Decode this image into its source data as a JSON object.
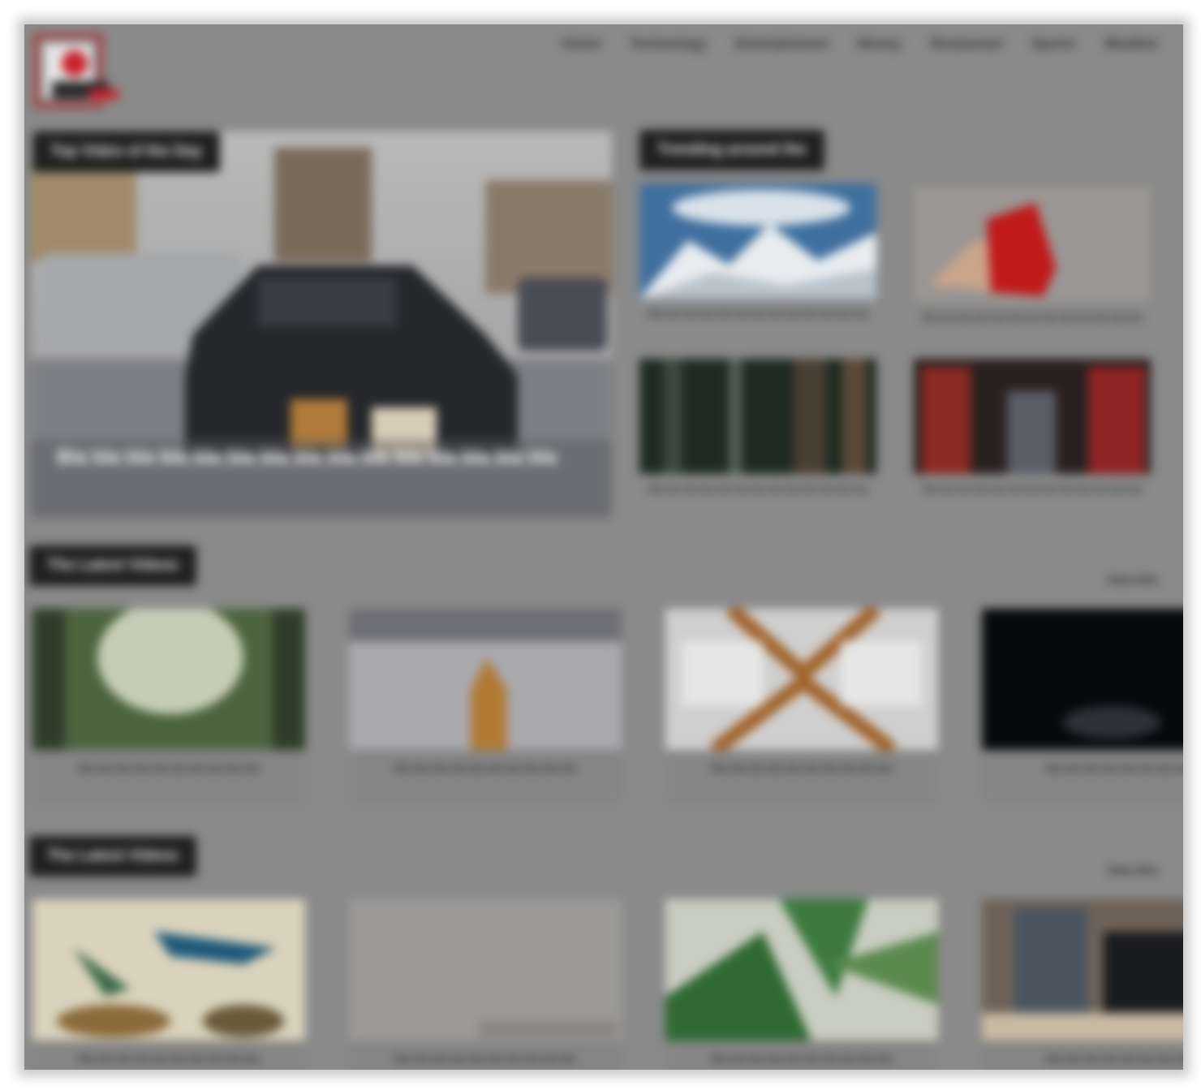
{
  "header": {
    "logo_icon": "red-square-logo-icon",
    "nav": [
      "Home",
      "Technology",
      "Entertainment",
      "Money",
      "Restaurant",
      "Sports",
      "Weather"
    ]
  },
  "hero": {
    "chip": "Top Video of the Day",
    "caption": "Bla bla bla bla bla bla bla bla bla bla bla bla bla bla bla",
    "image": "car-crash-photo"
  },
  "trending": {
    "chip": "Trending around the",
    "items": [
      {
        "caption": "Bla bla bla bla bla bla bla bla bla bla bla bla bla",
        "image": "snowy-mountains-photo"
      },
      {
        "caption": "Bla bla bla bla bla bla bla bla bla bla bla bla bla",
        "image": "red-bag-photo"
      },
      {
        "caption": "Bla bla bla bla bla bla bla bla bla bla bla bla bla",
        "image": "forest-photo"
      },
      {
        "caption": "Bla bla bla bla bla bla bla bla bla bla bla bla bla",
        "image": "mannequins-photo"
      }
    ]
  },
  "latest_1": {
    "chip": "The Latest Videos",
    "view_all": "View All ▸",
    "cards": [
      {
        "caption": "Bla bla bla bla bla bla bla bla bla bla",
        "image": "foggy-forest-photo"
      },
      {
        "caption": "Bla bla bla bla bla bla bla bla bla bla",
        "image": "fox-photo"
      },
      {
        "caption": "Bla bla bla bla bla bla bla bla bla bla",
        "image": "building-glass-photo"
      },
      {
        "caption": "Bla bla bla bla bla bla bla bla",
        "image": "night-sky-photo"
      }
    ]
  },
  "latest_2": {
    "chip": "The Latest Videos",
    "view_all": "View All ▸",
    "cards": [
      {
        "caption": "Bla bla bla bla bla bla bla bla bla bla",
        "image": "birds-painting-photo"
      },
      {
        "caption": "Bla bla bla bla bla bla bla bla bla bla",
        "image": "grey-wall-photo"
      },
      {
        "caption": "Bla bla bla bla bla bla bla bla bla bla",
        "image": "green-leaves-photo"
      },
      {
        "caption": "Bla bla bla bla bla bla bla bla",
        "image": "street-scene-photo"
      }
    ]
  },
  "colors": {
    "overlay": "#8a8a8a",
    "chip_bg": "#1f1f1f",
    "logo_red": "#c8202a"
  }
}
